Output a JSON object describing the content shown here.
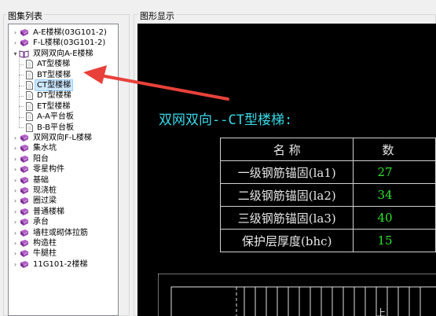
{
  "panels": {
    "tree_title": "图集列表",
    "graphic_title": "图形显示"
  },
  "tree": {
    "items": [
      {
        "label": "A-E楼梯(03G101-2)",
        "level": 0,
        "expanded": false,
        "icon": "book-icon"
      },
      {
        "label": "F-L楼梯(03G101-2)",
        "level": 0,
        "expanded": false,
        "icon": "book-icon"
      },
      {
        "label": "双网双向A-E楼梯",
        "level": 0,
        "expanded": true,
        "icon": "open-book-icon"
      },
      {
        "label": "AT型楼梯",
        "level": 1,
        "icon": "document-icon"
      },
      {
        "label": "BT型楼梯",
        "level": 1,
        "icon": "document-icon"
      },
      {
        "label": "CT型楼梯",
        "level": 1,
        "icon": "document-icon",
        "selected": true
      },
      {
        "label": "DT型楼梯",
        "level": 1,
        "icon": "document-icon"
      },
      {
        "label": "ET型楼梯",
        "level": 1,
        "icon": "document-icon"
      },
      {
        "label": "A-A平台板",
        "level": 1,
        "icon": "document-icon"
      },
      {
        "label": "B-B平台板",
        "level": 1,
        "icon": "document-icon"
      },
      {
        "label": "双网双向F-L楼梯",
        "level": 0,
        "expanded": false,
        "icon": "book-icon"
      },
      {
        "label": "集水坑",
        "level": 0,
        "expanded": false,
        "icon": "book-icon"
      },
      {
        "label": "阳台",
        "level": 0,
        "expanded": false,
        "icon": "book-icon"
      },
      {
        "label": "零星构件",
        "level": 0,
        "expanded": false,
        "icon": "book-icon"
      },
      {
        "label": "基础",
        "level": 0,
        "expanded": false,
        "icon": "book-icon"
      },
      {
        "label": "现浇桩",
        "level": 0,
        "expanded": false,
        "icon": "book-icon"
      },
      {
        "label": "圈过梁",
        "level": 0,
        "expanded": false,
        "icon": "book-icon"
      },
      {
        "label": "普通楼梯",
        "level": 0,
        "expanded": false,
        "icon": "book-icon"
      },
      {
        "label": "承台",
        "level": 0,
        "expanded": false,
        "icon": "book-icon"
      },
      {
        "label": "墙柱或砌体拉筋",
        "level": 0,
        "expanded": false,
        "icon": "book-icon"
      },
      {
        "label": "构造柱",
        "level": 0,
        "expanded": false,
        "icon": "book-icon"
      },
      {
        "label": "牛腿柱",
        "level": 0,
        "expanded": false,
        "icon": "book-icon"
      },
      {
        "label": "11G101-2楼梯",
        "level": 0,
        "expanded": false,
        "icon": "book-icon"
      }
    ]
  },
  "drawing": {
    "title": "双网双向--CT型楼梯:",
    "table_header": {
      "name": "名    称",
      "value": "数"
    },
    "params": [
      {
        "name": "一级钢筋锚固(la1)",
        "value": "27"
      },
      {
        "name": "二级钢筋锚固(la2)",
        "value": "34"
      },
      {
        "name": "三级钢筋锚固(la3)",
        "value": "40"
      },
      {
        "name": "保护层厚度(bhc)",
        "value": "15"
      }
    ],
    "stair_label": "上"
  },
  "colors": {
    "canvas_bg": "#000000",
    "title_cyan": "#37d9e8",
    "value_green": "#2ee22e",
    "annotation_arrow": "#e8413a",
    "selection": "#cce8ff"
  }
}
